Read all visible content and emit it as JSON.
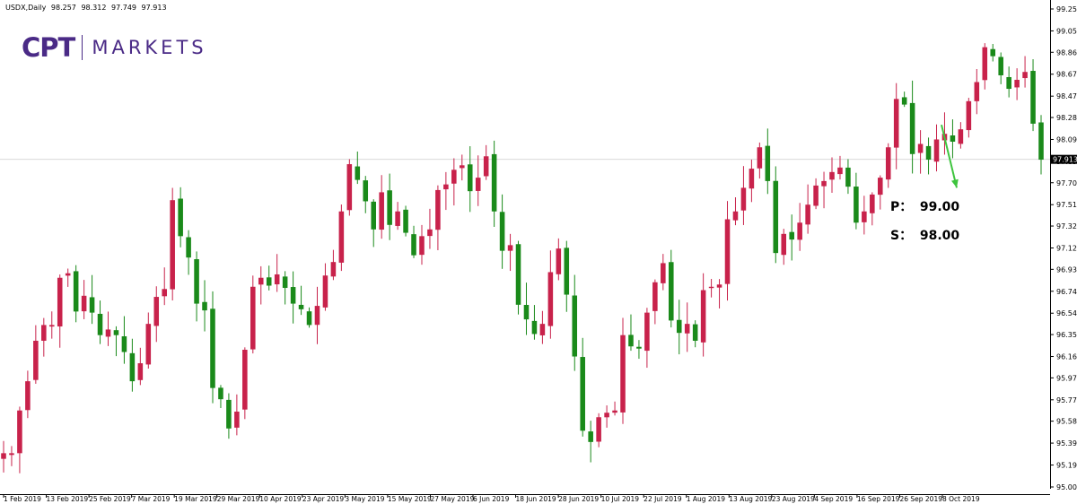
{
  "header": {
    "symbol": "USDX,Daily",
    "open": "98.257",
    "high": "98.312",
    "low": "97.749",
    "close": "97.913"
  },
  "logo": {
    "mark": "CPT",
    "word": "MARKETS"
  },
  "annotations": {
    "p_label": "P：",
    "p_value": "99.00",
    "s_label": "S：",
    "s_value": "98.00"
  },
  "colors": {
    "bull": "#1a8a1a",
    "bear": "#c8224b",
    "arrow": "#3ec43e",
    "grid": "#d9d9d9",
    "axis": "#000000",
    "logo": "#4a2a86"
  },
  "chart_data": {
    "type": "candlestick",
    "ylim": [
      95.0,
      99.25
    ],
    "yticks": [
      "99.250",
      "99.055",
      "98.865",
      "98.670",
      "98.475",
      "98.285",
      "98.090",
      "97.895",
      "97.705",
      "97.510",
      "97.320",
      "97.125",
      "96.935",
      "96.740",
      "96.545",
      "96.355",
      "96.160",
      "95.970",
      "95.775",
      "95.585",
      "95.390",
      "95.195",
      "95.000"
    ],
    "current_price": "97.913",
    "xticks": [
      "1 Feb 2019",
      "13 Feb 2019",
      "25 Feb 2019",
      "7 Mar 2019",
      "19 Mar 2019",
      "29 Mar 2019",
      "10 Apr 2019",
      "23 Apr 2019",
      "3 May 2019",
      "15 May 2019",
      "27 May 2019",
      "6 Jun 2019",
      "18 Jun 2019",
      "28 Jun 2019",
      "10 Jul 2019",
      "22 Jul 2019",
      "1 Aug 2019",
      "13 Aug 2019",
      "23 Aug 2019",
      "4 Sep 2019",
      "16 Sep 2019",
      "26 Sep 2019",
      "8 Oct 2019"
    ],
    "target_arrow": {
      "from": 98.22,
      "to": 97.66
    },
    "close_path": [
      95.3,
      95.3,
      95.68,
      95.94,
      96.3,
      96.44,
      96.44,
      96.86,
      96.9,
      96.56,
      96.7,
      96.55,
      96.35,
      96.4,
      96.35,
      96.2,
      95.94,
      96.1,
      96.45,
      96.69,
      96.76,
      97.55,
      97.23,
      97.04,
      96.63,
      96.57,
      95.88,
      95.78,
      95.52,
      95.67,
      96.22,
      96.78,
      96.86,
      96.79,
      96.89,
      96.77,
      96.63,
      96.58,
      96.44,
      96.61,
      96.88,
      97.0,
      97.45,
      97.87,
      97.73,
      97.54,
      97.29,
      97.62,
      97.33,
      97.45,
      97.26,
      97.06,
      97.23,
      97.29,
      97.64,
      97.69,
      97.82,
      97.86,
      97.63,
      97.75,
      97.94,
      97.45,
      97.1,
      97.15,
      96.62,
      96.49,
      96.36,
      96.45,
      96.91,
      97.12,
      96.71,
      96.16,
      95.5,
      95.4,
      95.62,
      95.66,
      95.68,
      96.35,
      96.25,
      96.23,
      96.55,
      96.82,
      96.99,
      96.48,
      96.37,
      96.45,
      96.3,
      96.75,
      96.78,
      96.8,
      97.38,
      97.45,
      97.66,
      97.83,
      98.02,
      97.72,
      97.08,
      97.25,
      97.2,
      97.35,
      97.51,
      97.68,
      97.72,
      97.8,
      97.84,
      97.67,
      97.35,
      97.45,
      97.6,
      97.75,
      98.02,
      98.45,
      98.4,
      97.96,
      98.05,
      97.91,
      98.09,
      98.14,
      98.07,
      98.18,
      98.43,
      98.6,
      98.91,
      98.83,
      98.66,
      98.54,
      98.62,
      98.69,
      98.23,
      97.91
    ]
  }
}
